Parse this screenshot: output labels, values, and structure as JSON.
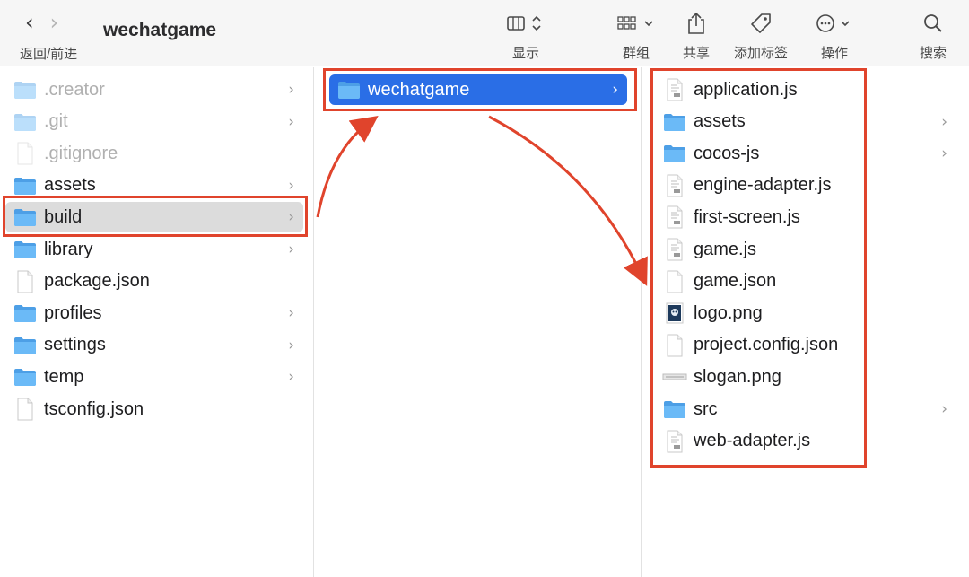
{
  "toolbar": {
    "back_forward_label": "返回/前进",
    "title": "wechatgame",
    "view_label": "显示",
    "group_label": "群组",
    "share_label": "共享",
    "tags_label": "添加标签",
    "action_label": "操作",
    "search_label": "搜索"
  },
  "columns": [
    {
      "items": [
        {
          "name": ".creator",
          "kind": "folder",
          "dim": true,
          "chevron": true
        },
        {
          "name": ".git",
          "kind": "folder",
          "dim": true,
          "chevron": true
        },
        {
          "name": ".gitignore",
          "kind": "file",
          "dim": true,
          "chevron": false
        },
        {
          "name": "assets",
          "kind": "folder",
          "dim": false,
          "chevron": true
        },
        {
          "name": "build",
          "kind": "folder",
          "dim": false,
          "chevron": true,
          "selected": "inactive"
        },
        {
          "name": "library",
          "kind": "folder",
          "dim": false,
          "chevron": true
        },
        {
          "name": "package.json",
          "kind": "file",
          "dim": false,
          "chevron": false
        },
        {
          "name": "profiles",
          "kind": "folder",
          "dim": false,
          "chevron": true
        },
        {
          "name": "settings",
          "kind": "folder",
          "dim": false,
          "chevron": true
        },
        {
          "name": "temp",
          "kind": "folder",
          "dim": false,
          "chevron": true
        },
        {
          "name": "tsconfig.json",
          "kind": "file",
          "dim": false,
          "chevron": false
        }
      ]
    },
    {
      "items": [
        {
          "name": "wechatgame",
          "kind": "folder",
          "dim": false,
          "chevron": true,
          "selected": "active"
        }
      ]
    },
    {
      "items": [
        {
          "name": "application.js",
          "kind": "js",
          "dim": false,
          "chevron": false
        },
        {
          "name": "assets",
          "kind": "folder",
          "dim": false,
          "chevron": true
        },
        {
          "name": "cocos-js",
          "kind": "folder",
          "dim": false,
          "chevron": true
        },
        {
          "name": "engine-adapter.js",
          "kind": "js",
          "dim": false,
          "chevron": false
        },
        {
          "name": "first-screen.js",
          "kind": "js",
          "dim": false,
          "chevron": false
        },
        {
          "name": "game.js",
          "kind": "js",
          "dim": false,
          "chevron": false
        },
        {
          "name": "game.json",
          "kind": "file",
          "dim": false,
          "chevron": false
        },
        {
          "name": "logo.png",
          "kind": "image",
          "dim": false,
          "chevron": false
        },
        {
          "name": "project.config.json",
          "kind": "file",
          "dim": false,
          "chevron": false
        },
        {
          "name": "slogan.png",
          "kind": "banner",
          "dim": false,
          "chevron": false
        },
        {
          "name": "src",
          "kind": "folder",
          "dim": false,
          "chevron": true
        },
        {
          "name": "web-adapter.js",
          "kind": "js",
          "dim": false,
          "chevron": false
        }
      ]
    }
  ],
  "colors": {
    "selection_blue": "#2a6ee6",
    "selection_gray": "#dcdcdc",
    "folder_blue": "#5fb3f5",
    "annotation_red": "#e0442c"
  }
}
